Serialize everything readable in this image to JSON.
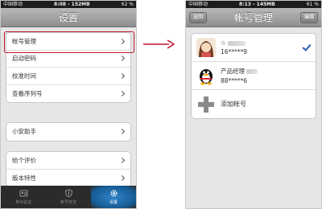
{
  "left_screen": {
    "status": {
      "carrier": "中国移动",
      "time": "8:08 - 152MB",
      "battery": "62 %"
    },
    "title": "设置",
    "groups": [
      {
        "items": [
          {
            "label": "帐号管理",
            "highlighted": true
          },
          {
            "label": "启动密码"
          },
          {
            "label": "校准时间"
          },
          {
            "label": "查看序列号"
          }
        ]
      },
      {
        "items": [
          {
            "label": "小安助手"
          }
        ]
      },
      {
        "items": [
          {
            "label": "给个评价"
          },
          {
            "label": "版本特性"
          }
        ]
      }
    ],
    "tabs": [
      {
        "label": "身份验证",
        "icon": "id-card-icon",
        "active": false
      },
      {
        "label": "帐号安全",
        "icon": "shield-icon",
        "active": false
      },
      {
        "label": "设置",
        "icon": "gear-icon",
        "active": true
      }
    ]
  },
  "right_screen": {
    "status": {
      "carrier": "中国移动",
      "time": "8:13 - 145MB",
      "battery": "61 %"
    },
    "title": "帐号管理",
    "back_label": "返回",
    "edit_label": "编辑",
    "accounts": [
      {
        "name": "☆",
        "number": "16*****9",
        "avatar": "girl-avatar-icon",
        "selected": true
      },
      {
        "name": "产品经理",
        "number": "88*****6",
        "avatar": "penguin-avatar-icon",
        "selected": false
      }
    ],
    "add_label": "添加帐号"
  },
  "colors": {
    "highlight": "#c0172b",
    "arrow": "#c0172b",
    "check": "#2a5db0",
    "active_tab": "#2f84c9"
  }
}
